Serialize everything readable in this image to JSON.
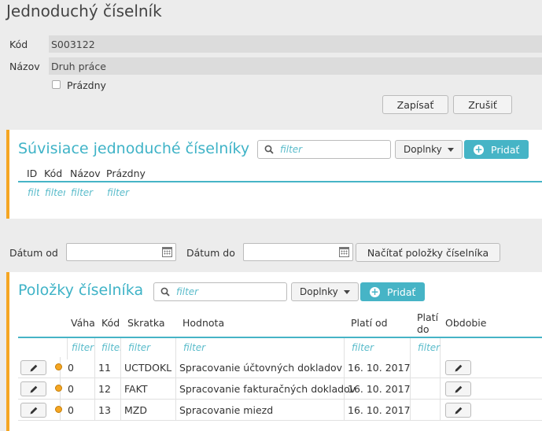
{
  "page": {
    "title": "Jednoduchý číselník"
  },
  "form": {
    "kod_label": "Kód",
    "kod_value": "S003122",
    "nazov_label": "Názov",
    "nazov_value": "Druh práce",
    "prazdny_label": "Prázdny",
    "prazdny_checked": false,
    "save_label": "Zapísať",
    "cancel_label": "Zrušiť"
  },
  "related": {
    "title": "Súvisiace jednoduché číselníky",
    "filter_placeholder": "filter",
    "addons_label": "Doplnky",
    "add_label": "Pridať",
    "columns": [
      "ID",
      "Kód",
      "Názov",
      "Prázdny"
    ],
    "filters": [
      "filt",
      "filter",
      "filter",
      "filter"
    ]
  },
  "dates": {
    "from_label": "Dátum od",
    "to_label": "Dátum do",
    "load_label": "Načítať položky číselníka"
  },
  "items": {
    "title": "Položky číselníka",
    "filter_placeholder": "filter",
    "addons_label": "Doplnky",
    "add_label": "Pridať",
    "columns": [
      "Váha",
      "Kód",
      "Skratka",
      "Hodnota",
      "Platí od",
      "Platí do",
      "Obdobie"
    ],
    "filters": [
      "filter",
      "filter",
      "filter",
      "filter",
      "filter",
      "filter"
    ],
    "rows": [
      {
        "vaha": "0",
        "kod": "11",
        "skratka": "UCTDOKL",
        "hodnota": "Spracovanie účtovných dokladov",
        "plati_od": "16. 10. 2017",
        "plati_do": ""
      },
      {
        "vaha": "0",
        "kod": "12",
        "skratka": "FAKT",
        "hodnota": "Spracovanie fakturačných dokladov",
        "plati_od": "16. 10. 2017",
        "plati_do": ""
      },
      {
        "vaha": "0",
        "kod": "13",
        "skratka": "MZD",
        "hodnota": "Spracovanie miezd",
        "plati_od": "16. 10. 2017",
        "plati_do": ""
      }
    ]
  },
  "icons": {
    "search": "search-icon",
    "edit": "pencil-icon",
    "calendar": "calendar-icon",
    "status": "status-dot-icon",
    "add": "plus-circle-icon",
    "caret": "caret-down-icon"
  },
  "colors": {
    "accent": "#46b4c6",
    "panel_border": "#f5a623",
    "status_dot": "#f5a623"
  }
}
